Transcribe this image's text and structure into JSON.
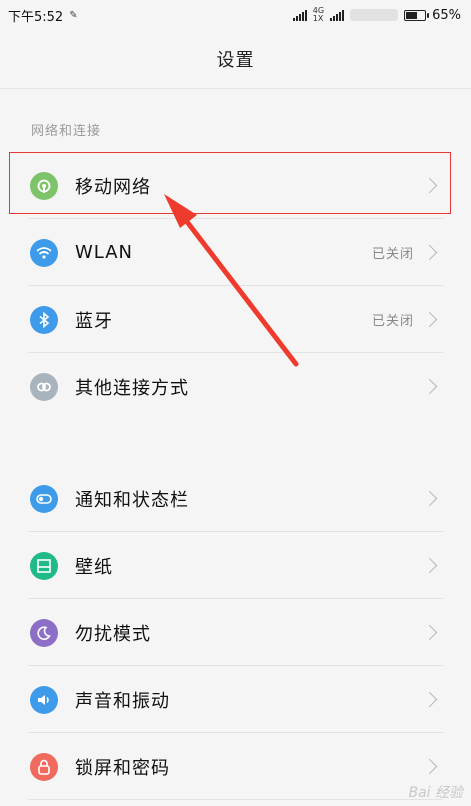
{
  "status_bar": {
    "time": "下午5:52",
    "network_type_top": "4G",
    "network_type_bottom": "1X",
    "battery_level": 0.65,
    "battery": "65%"
  },
  "title": "设置",
  "section": {
    "header": "网络和连接"
  },
  "group1": [
    {
      "name": "mobile-network",
      "label": "移动网络",
      "value": "",
      "icon": "mobile-network-icon",
      "color": "#7cc36a"
    },
    {
      "name": "wlan",
      "label": "WLAN",
      "value": "已关闭",
      "icon": "wifi-icon",
      "color": "#3d9be9"
    },
    {
      "name": "bluetooth",
      "label": "蓝牙",
      "value": "已关闭",
      "icon": "bluetooth-icon",
      "color": "#3d9be9"
    },
    {
      "name": "other-connections",
      "label": "其他连接方式",
      "value": "",
      "icon": "link-icon",
      "color": "#a9b3bd"
    }
  ],
  "group2": [
    {
      "name": "notifications-statusbar",
      "label": "通知和状态栏",
      "value": "",
      "icon": "toggle-icon",
      "color": "#3d9be9"
    },
    {
      "name": "wallpaper",
      "label": "壁纸",
      "value": "",
      "icon": "wallpaper-icon",
      "color": "#1fb98a"
    },
    {
      "name": "do-not-disturb",
      "label": "勿扰模式",
      "value": "",
      "icon": "moon-icon",
      "color": "#8d6fc8"
    },
    {
      "name": "sound-vibration",
      "label": "声音和振动",
      "value": "",
      "icon": "speaker-icon",
      "color": "#3d9be9"
    },
    {
      "name": "lockscreen-password",
      "label": "锁屏和密码",
      "value": "",
      "icon": "lock-icon",
      "color": "#f06a5e"
    }
  ],
  "watermark": "Bai 经验"
}
